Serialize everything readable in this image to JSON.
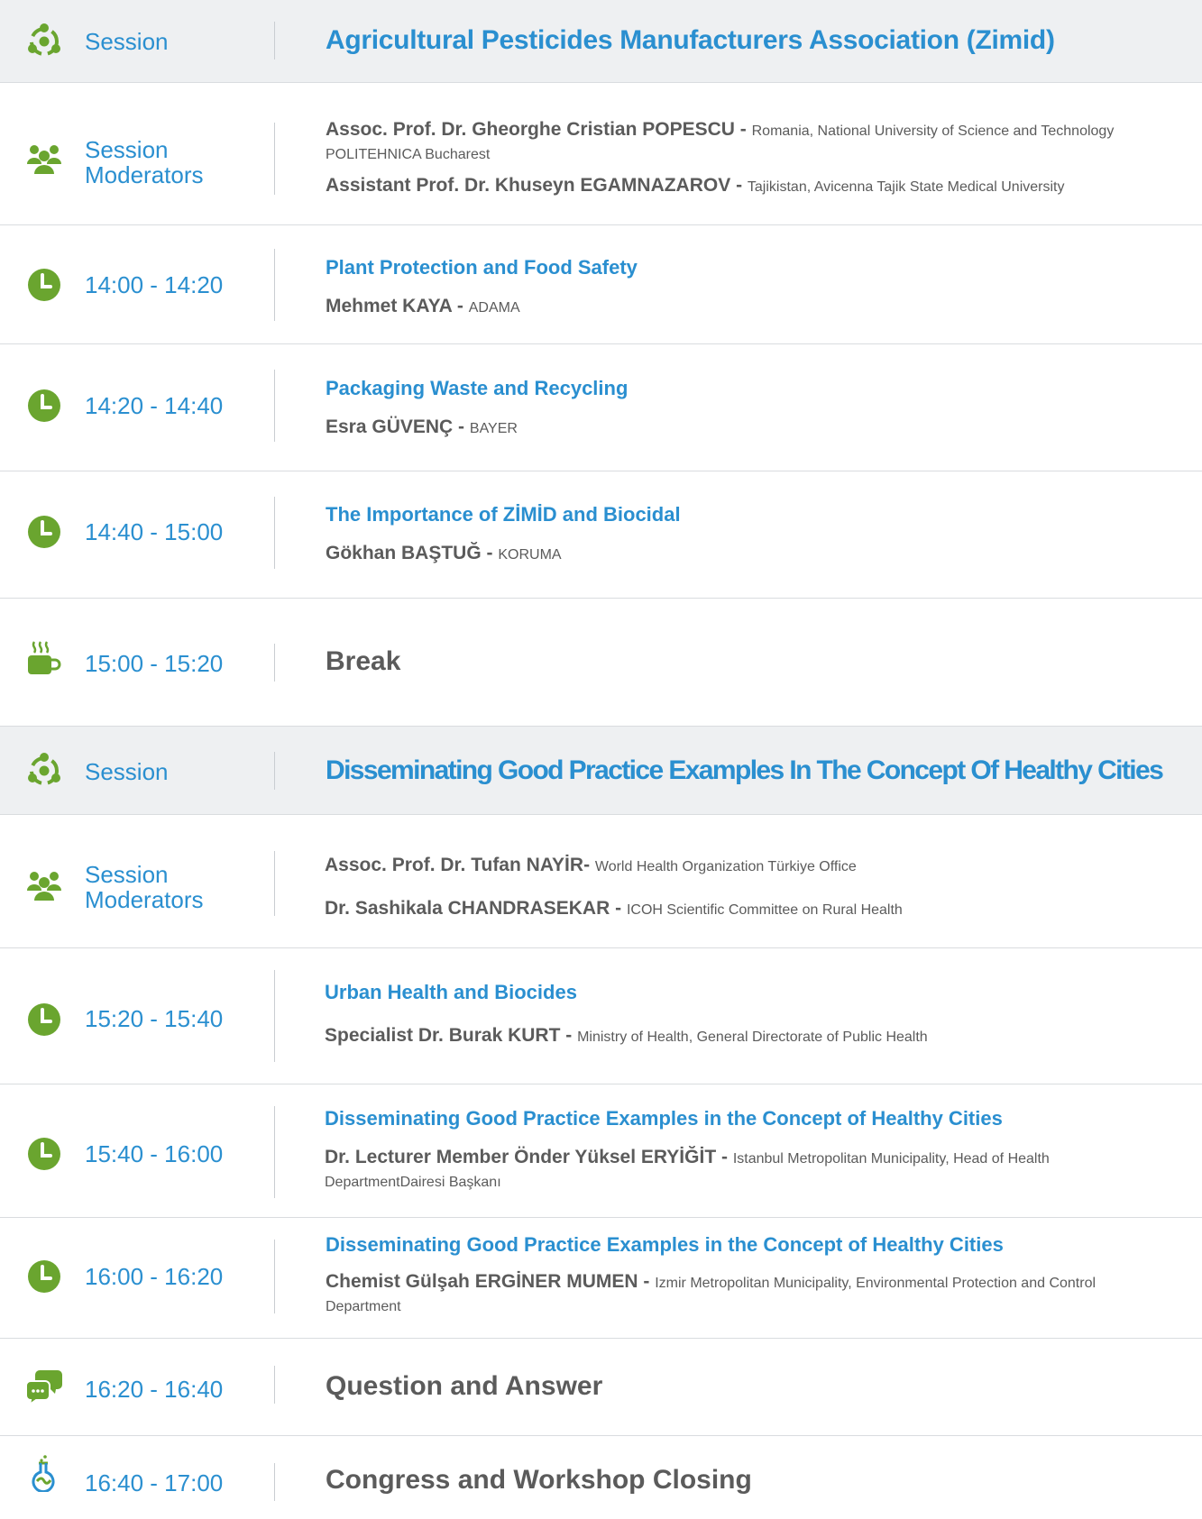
{
  "colors": {
    "accent_blue": "#2a8fd0",
    "icon_green": "#6aa52f",
    "session_bg": "#eef0f2",
    "text_gray": "#5b5b5b"
  },
  "rows": {
    "r1": {
      "icon": "session-network-icon",
      "label": "Session",
      "title": "Agricultural Pesticides Manufacturers Association (Zimid)"
    },
    "r2": {
      "icon": "people-group-icon",
      "label_line1": "Session",
      "label_line2": "Moderators",
      "speakers": [
        {
          "name": "Assoc. Prof. Dr. Gheorghe Cristian POPESCU",
          "sep": " - ",
          "aff": "Romania, National University of Science and Technology POLITEHNICA Bucharest"
        },
        {
          "name": "Assistant Prof. Dr. Khuseyn EGAMNAZAROV",
          "sep": " - ",
          "aff": "Tajikistan, Avicenna Tajik State Medical University"
        }
      ]
    },
    "r3": {
      "icon": "clock-icon",
      "time": "14:00 - 14:20",
      "title": "Plant Protection and Food Safety",
      "speaker": {
        "name": "Mehmet KAYA",
        "sep": " - ",
        "aff": "ADAMA"
      }
    },
    "r4": {
      "icon": "clock-icon",
      "time": "14:20 - 14:40",
      "title": "Packaging Waste and Recycling",
      "speaker": {
        "name": "Esra GÜVENÇ",
        "sep": " - ",
        "aff": "BAYER"
      }
    },
    "r5": {
      "icon": "clock-icon",
      "time": "14:40 - 15:00",
      "title": "The Importance of ZİMİD and Biocidal",
      "speaker": {
        "name": "Gökhan BAŞTUĞ",
        "sep": " - ",
        "aff": "KORUMA"
      }
    },
    "r6": {
      "icon": "coffee-cup-icon",
      "time": "15:00 - 15:20",
      "title": "Break"
    },
    "r7": {
      "icon": "session-network-icon",
      "label": "Session",
      "title": "Disseminating Good Practice Examples In The Concept Of Healthy Cities"
    },
    "r8": {
      "icon": "people-group-icon",
      "label_line1": "Session",
      "label_line2": "Moderators",
      "speakers": [
        {
          "name": "Assoc. Prof.  Dr. Tufan NAYİR",
          "sep": "- ",
          "aff": "World Health Organization Türkiye Office"
        },
        {
          "name": "Dr. Sashikala CHANDRASEKAR",
          "sep": " - ",
          "aff": "ICOH Scientific Committee on Rural Health"
        }
      ]
    },
    "r9": {
      "icon": "clock-icon",
      "time": "15:20 - 15:40",
      "title": "Urban Health and Biocides",
      "speaker": {
        "name": "Specialist Dr. Burak KURT",
        "sep": " - ",
        "aff": "Ministry of Health, General Directorate of Public Health"
      }
    },
    "r10": {
      "icon": "clock-icon",
      "time": "15:40 - 16:00",
      "title": "Disseminating Good Practice Examples in the Concept of Healthy Cities",
      "speaker": {
        "name": "Dr. Lecturer Member Önder Yüksel ERYİĞİT",
        "sep": " - ",
        "aff": "Istanbul Metropolitan Municipality, Head of Health DepartmentDairesi Başkanı"
      }
    },
    "r11": {
      "icon": "clock-icon",
      "time": "16:00 - 16:20",
      "title": "Disseminating Good Practice Examples in the Concept of Healthy Cities",
      "speaker": {
        "name": "Chemist Gülşah ERGİNER MUMEN",
        "sep": " - ",
        "aff": "Izmir Metropolitan Municipality, Environmental Protection and Control Department"
      }
    },
    "r12": {
      "icon": "chat-bubbles-icon",
      "time": "16:20 - 16:40",
      "title": "Question and Answer"
    },
    "r13": {
      "icon": "flask-icon",
      "time": "16:40 - 17:00",
      "title": "Congress and Workshop Closing"
    }
  }
}
